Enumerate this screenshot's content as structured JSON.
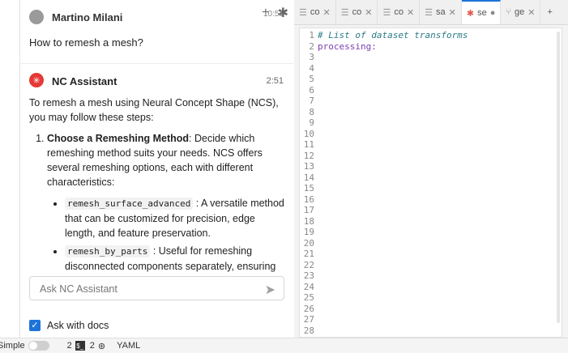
{
  "chat": {
    "user": {
      "name": "Martino Milani",
      "time": "10:51",
      "question": "How to remesh a mesh?"
    },
    "assistant": {
      "name": "NC Assistant",
      "time": "2:51",
      "intro": "To remesh a mesh using Neural Concept Shape (NCS), you may follow these steps:",
      "steps": [
        {
          "title": "Choose a Remeshing Method",
          "text": ": Decide which remeshing method suits your needs. NCS offers several remeshing options, each with different characteristics:",
          "bullets": [
            {
              "code": "remesh_surface_advanced",
              "text": " : A versatile method that can be customized for precision, edge length, and feature preservation."
            },
            {
              "code": "remesh_by_parts",
              "text": " : Useful for remeshing disconnected components separately, ensuring smaller"
            }
          ]
        }
      ]
    },
    "input_placeholder": "Ask NC Assistant",
    "ask_with_docs": "Ask with docs"
  },
  "editor": {
    "tabs": [
      {
        "label": "co",
        "icon": "file-icon",
        "active": false
      },
      {
        "label": "co",
        "icon": "file-icon",
        "active": false
      },
      {
        "label": "co",
        "icon": "file-icon",
        "active": false
      },
      {
        "label": "sa",
        "icon": "file-icon",
        "active": false
      },
      {
        "label": "se",
        "icon": "gear-icon",
        "active": true
      },
      {
        "label": "ge",
        "icon": "branch-icon",
        "active": false
      }
    ],
    "lines": [
      "# List of dataset transforms",
      "processing:"
    ],
    "line_count": 28
  },
  "status": {
    "mode": "Simple",
    "count_a": "2",
    "count_b": "2",
    "language": "YAML"
  }
}
